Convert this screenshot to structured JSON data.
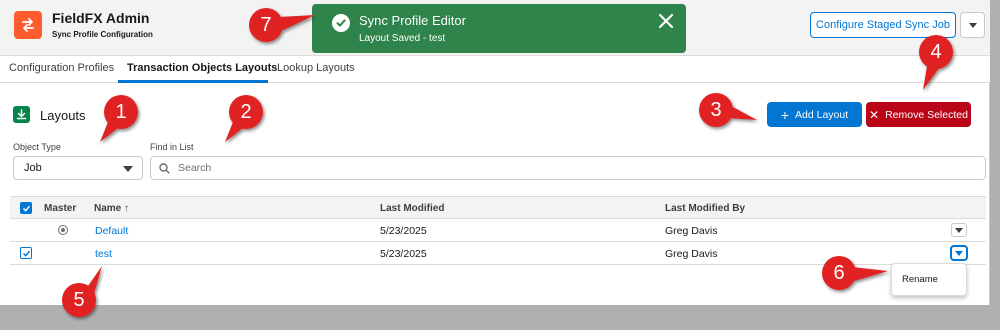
{
  "header": {
    "app_title": "FieldFX Admin",
    "app_subtitle": "Sync Profile Configuration",
    "config_button_label": "Configure Staged Sync Job",
    "icons": {
      "logo": "sync-arrows-icon",
      "menu": "chevron-down-icon"
    }
  },
  "toast": {
    "title": "Sync Profile Editor",
    "message": "Layout Saved - test",
    "icon": "success-check-icon",
    "close_icon": "close-icon",
    "color": "#2e844a"
  },
  "tabs": [
    {
      "label": "Configuration Profiles",
      "active": false
    },
    {
      "label": "Transaction Objects Layouts",
      "active": true
    },
    {
      "label": "Lookup Layouts",
      "active": false
    }
  ],
  "layouts": {
    "title": "Layouts",
    "add_button_label": "Add Layout",
    "remove_button_label": "Remove Selected",
    "object_type_label": "Object Type",
    "object_type_value": "Job",
    "find_label": "Find in List",
    "search_placeholder": "Search"
  },
  "table": {
    "columns": {
      "master": "Master",
      "name": "Name",
      "name_sort_indicator": "↑",
      "last_modified": "Last Modified",
      "last_modified_by": "Last Modified By"
    },
    "rows": [
      {
        "selected": false,
        "master": true,
        "name": "Default",
        "last_modified": "5/23/2025",
        "last_modified_by": "Greg Davis"
      },
      {
        "selected": true,
        "master": false,
        "name": "test",
        "last_modified": "5/23/2025",
        "last_modified_by": "Greg Davis"
      }
    ]
  },
  "row_menu": {
    "items": [
      "Rename"
    ]
  },
  "callouts": [
    "1",
    "2",
    "3",
    "4",
    "5",
    "6",
    "7"
  ],
  "colors": {
    "brand": "#0176d3",
    "danger": "#ba0517",
    "success": "#2e844a",
    "callout": "#e02020",
    "logo": "#ff5d2d"
  }
}
